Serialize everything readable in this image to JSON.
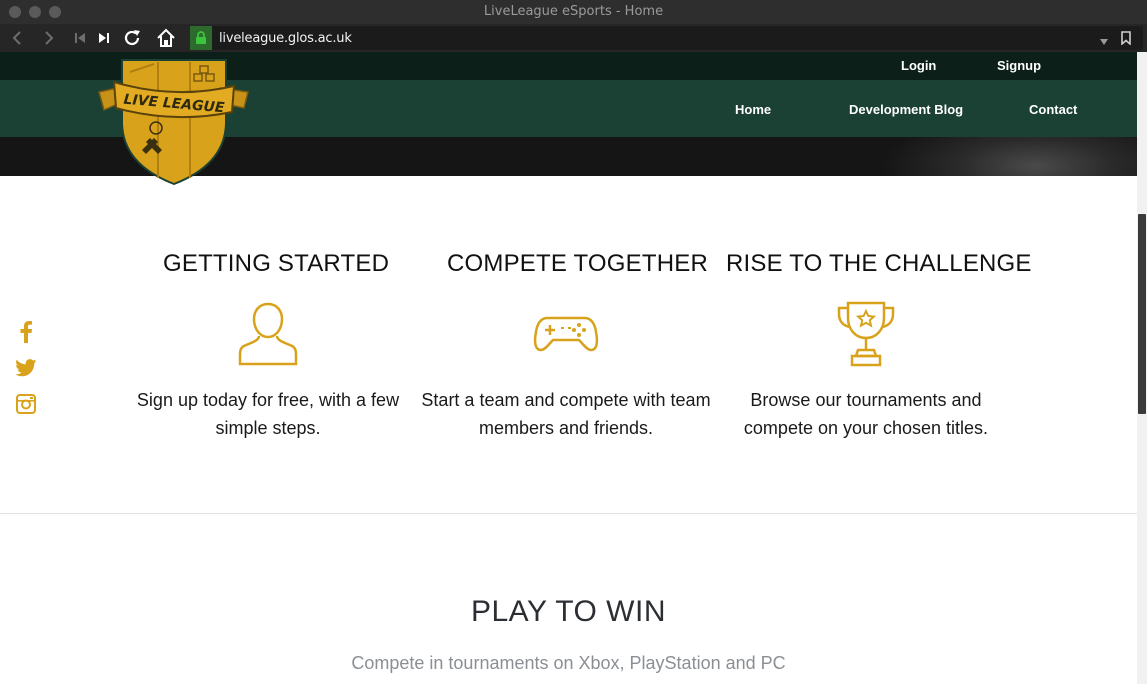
{
  "browser": {
    "window_title": "LiveLeague eSports - Home",
    "url": "liveleague.glos.ac.uk"
  },
  "site": {
    "logo_text": "LIVE LEAGUE",
    "top_nav": [
      "Login",
      "Signup"
    ],
    "main_nav": [
      "Home",
      "Development Blog",
      "Contact"
    ],
    "social": [
      "facebook-icon",
      "twitter-icon",
      "instagram-icon"
    ],
    "features": [
      {
        "title": "GETTING STARTED",
        "icon": "user-icon",
        "desc": "Sign up today for free, with a few simple steps."
      },
      {
        "title": "COMPETE TOGETHER",
        "icon": "gamepad-icon",
        "desc": "Start a team and compete with team members and friends."
      },
      {
        "title": "RISE TO THE CHALLENGE",
        "icon": "trophy-icon",
        "desc": "Browse our tournaments and compete on your chosen titles."
      }
    ],
    "section": {
      "title": "PLAY TO WIN",
      "subtitle": "Compete in tournaments on Xbox, PlayStation and PC"
    }
  },
  "colors": {
    "accent": "#d9a21b",
    "nav_bg": "#1b4135",
    "top_nav_bg": "#0c1f18",
    "chrome_bg": "#262626"
  }
}
